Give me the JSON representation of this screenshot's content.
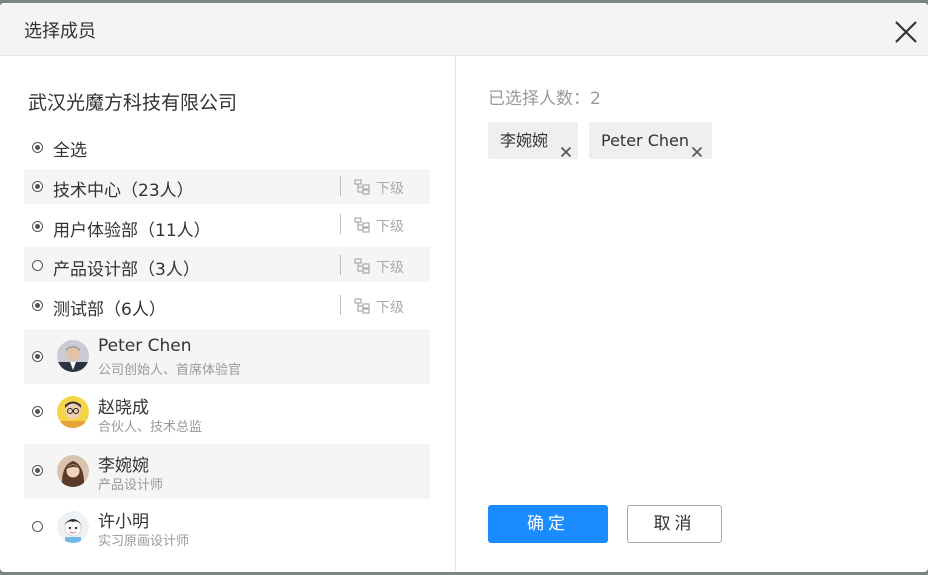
{
  "dialog": {
    "title": "选择成员",
    "close_icon": "close-icon"
  },
  "left": {
    "company": "武汉光魔方科技有限公司",
    "select_all": {
      "label": "全选",
      "checked": true
    },
    "departments": [
      {
        "label": "技术中心（23人）",
        "checked": true,
        "sub_label": "下级"
      },
      {
        "label": "用户体验部（11人）",
        "checked": true,
        "sub_label": "下级"
      },
      {
        "label": "产品设计部（3人）",
        "checked": false,
        "sub_label": "下级"
      },
      {
        "label": "测试部（6人）",
        "checked": true,
        "sub_label": "下级"
      }
    ],
    "members": [
      {
        "name": "Peter Chen",
        "role": "公司创始人、首席体验官",
        "checked": true,
        "avatar": "avatar-man-suit"
      },
      {
        "name": "赵晓成",
        "role": "合伙人、技术总监",
        "checked": true,
        "avatar": "avatar-man-glasses"
      },
      {
        "name": "李婉婉",
        "role": "产品设计师",
        "checked": true,
        "avatar": "avatar-woman"
      },
      {
        "name": "许小明",
        "role": "实习原画设计师",
        "checked": false,
        "avatar": "avatar-cartoon"
      }
    ]
  },
  "right": {
    "count_text": "已选择人数：2",
    "selected": [
      {
        "name": "李婉婉"
      },
      {
        "name": "Peter Chen"
      }
    ],
    "confirm_label": "确定",
    "cancel_label": "取消"
  },
  "colors": {
    "primary": "#1a8cff",
    "backdrop": "#7d8584",
    "header": "#f4f4f4",
    "row_shade": "#f5f5f5"
  }
}
